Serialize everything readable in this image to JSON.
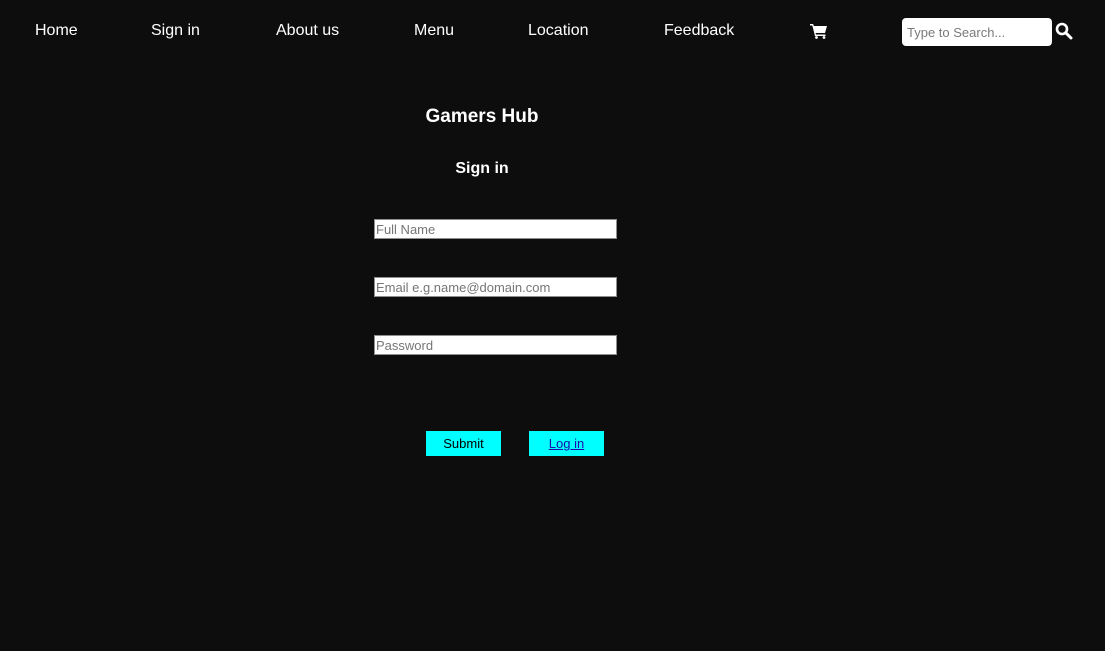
{
  "nav": {
    "items": [
      {
        "label": "Home"
      },
      {
        "label": "Sign in"
      },
      {
        "label": "About us"
      },
      {
        "label": "Menu"
      },
      {
        "label": "Location"
      },
      {
        "label": "Feedback"
      }
    ],
    "cart_icon": "shopping-cart-icon",
    "search": {
      "placeholder": "Type to Search...",
      "value": ""
    },
    "search_icon": "magnifier-icon"
  },
  "main": {
    "title": "Gamers Hub",
    "subtitle": "Sign in",
    "form": {
      "full_name": {
        "placeholder": "Full Name",
        "value": ""
      },
      "email": {
        "placeholder": "Email e.g.name@domain.com",
        "value": ""
      },
      "password": {
        "placeholder": "Password",
        "value": ""
      },
      "submit_label": "Submit",
      "login_label": "Log in"
    }
  },
  "colors": {
    "background": "#0e0d0e",
    "nav_text": "#ffffff",
    "button_accent": "#00ffff",
    "link": "#1a0dab"
  }
}
